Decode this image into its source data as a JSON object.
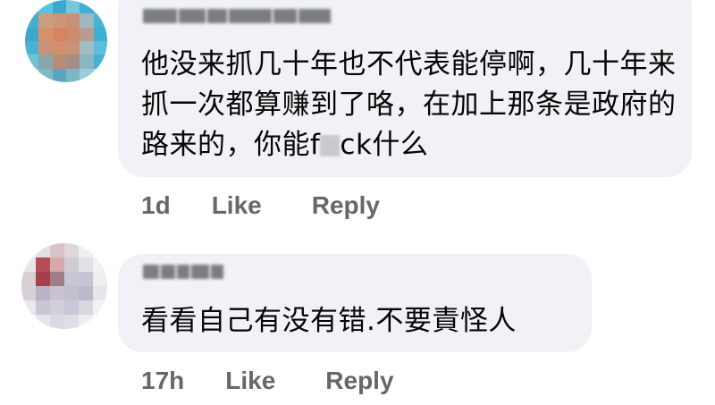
{
  "comments": [
    {
      "author_name": "",
      "text_before": "他没来抓几十年也不代表能停啊，几十年来抓一次都算赚到了咯，在加上那条是政府的路来的，你能f",
      "text_after": "ck什么",
      "timestamp": "1d",
      "like_label": "Like",
      "reply_label": "Reply"
    },
    {
      "author_name": "",
      "text": "看看自己有没有错.不要責怪人",
      "timestamp": "17h",
      "like_label": "Like",
      "reply_label": "Reply"
    }
  ],
  "colors": {
    "bubble_background": "#f0f2f5",
    "text": "#050505",
    "secondary_text": "#65676b"
  }
}
